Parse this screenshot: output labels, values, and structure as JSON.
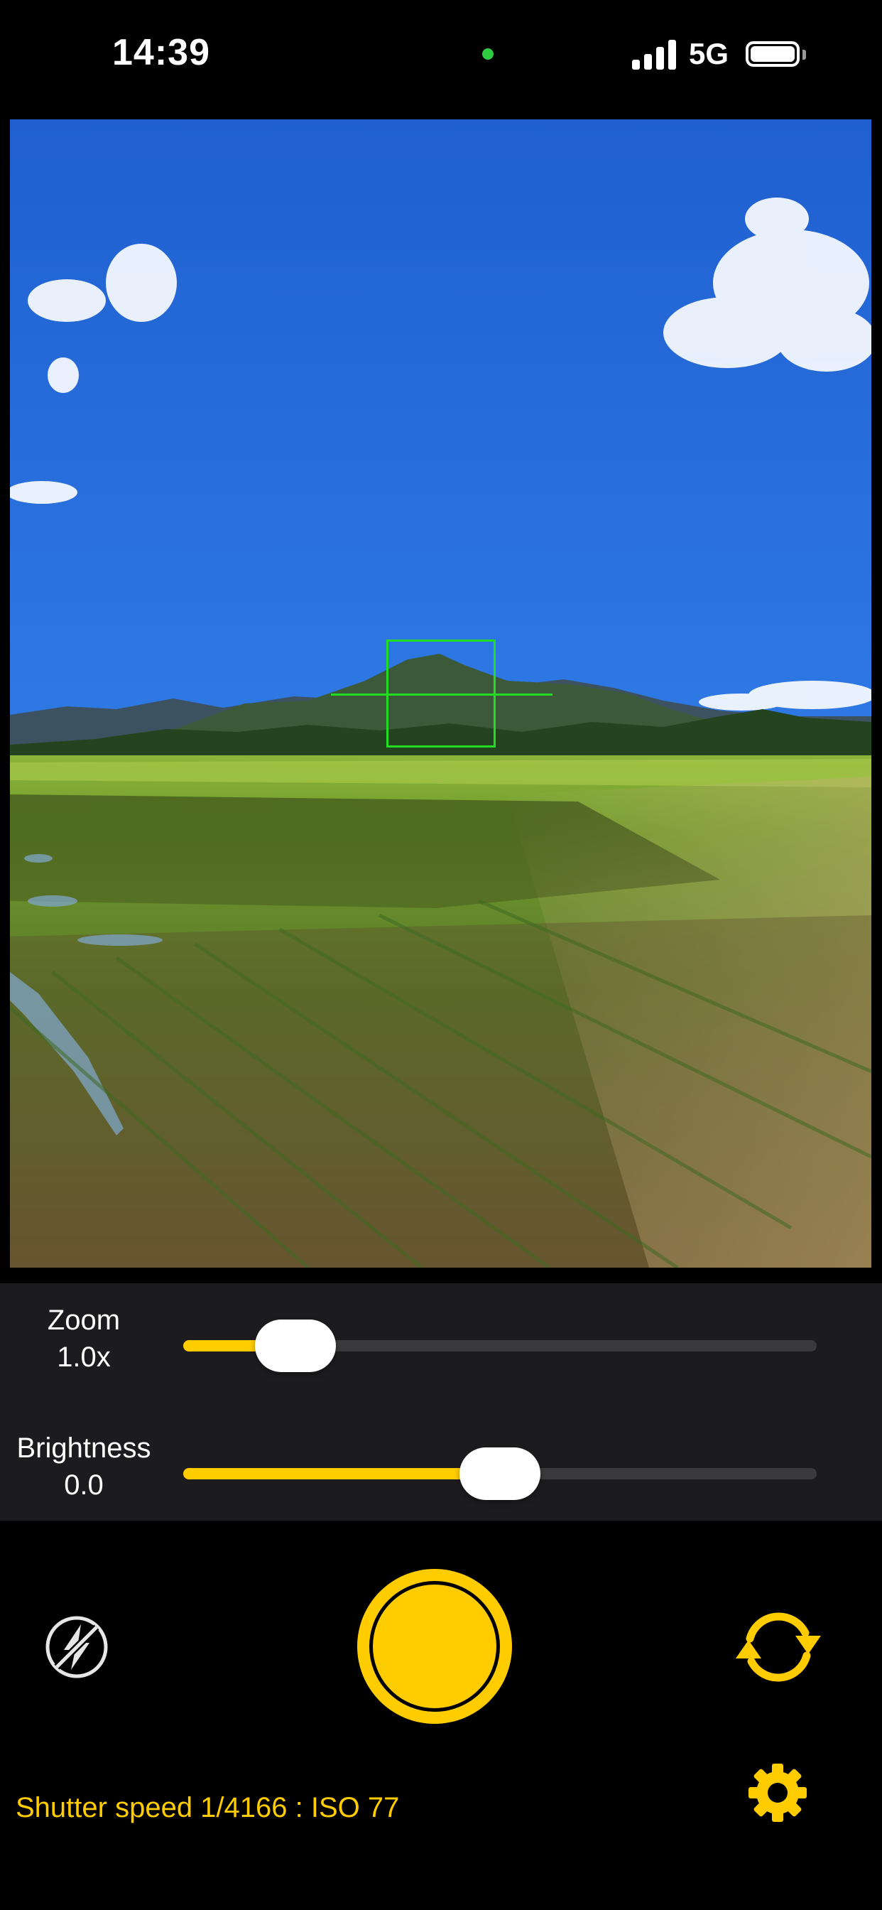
{
  "status_bar": {
    "time": "14:39",
    "network": "5G",
    "icons": [
      "camera-in-use-dot",
      "cellular-signal-icon",
      "battery-icon"
    ]
  },
  "viewfinder": {
    "overlay_icons": [
      "focus-box",
      "level-line"
    ]
  },
  "controls": {
    "zoom": {
      "label": "Zoom",
      "value": "1.0x",
      "level": 0.12
    },
    "brightness": {
      "label": "Brightness",
      "value": "0.0",
      "level": 0.5
    }
  },
  "bottom_bar": {
    "flash_icon": "flash-off-icon",
    "shutter_icon": "shutter-button",
    "flip_icon": "camera-flip-icon",
    "settings_icon": "gear-icon",
    "exposure_info": "Shutter speed 1/4166 : ISO 77"
  },
  "colors": {
    "accent": "#ffcc00",
    "focus": "#22dd22",
    "panel": "#1c1c1e",
    "track": "#3a3a3c"
  }
}
